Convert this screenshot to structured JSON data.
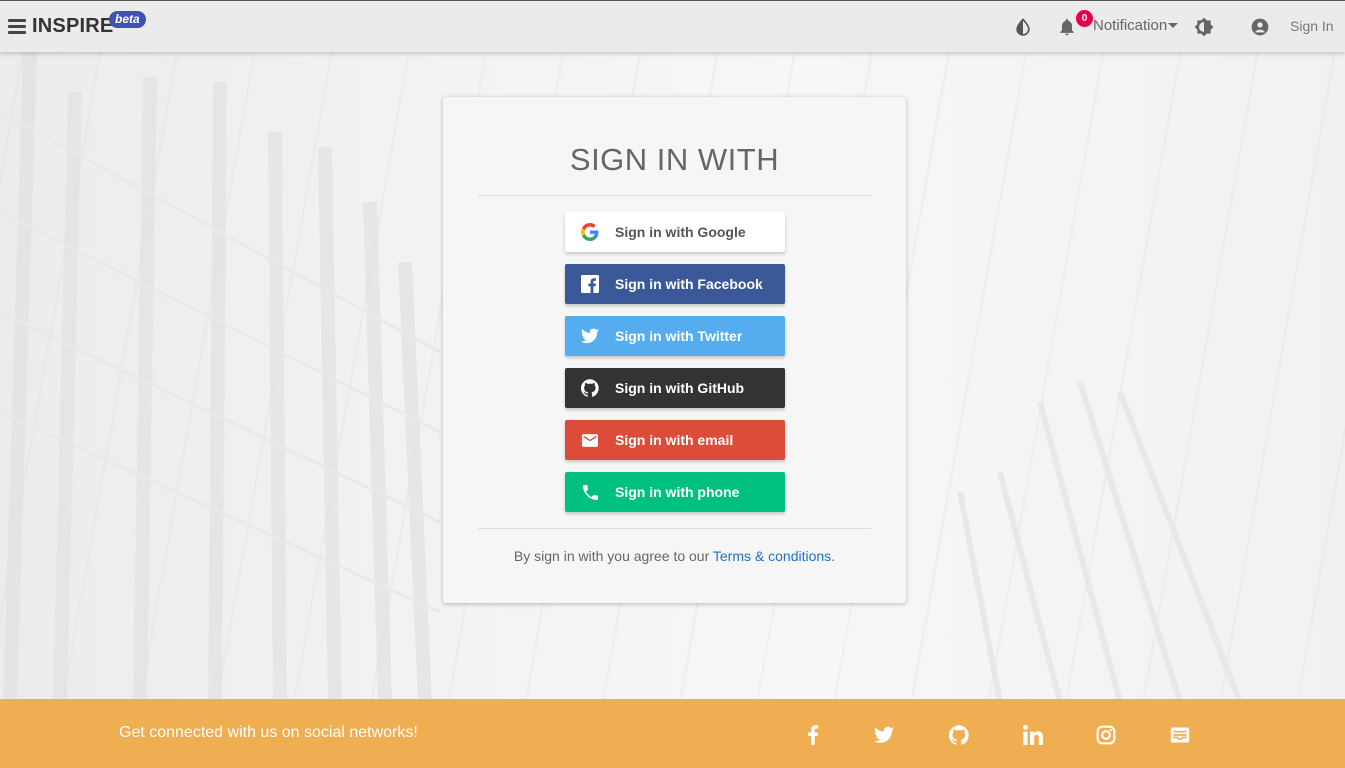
{
  "navbar": {
    "brand": "INSPIRE",
    "badge": "beta",
    "notification_count": "0",
    "notification_label": "Notification",
    "signin_label": "Sign In"
  },
  "card": {
    "title": "SIGN IN WITH",
    "buttons": [
      {
        "label": "Sign in with Google",
        "icon": "google-icon",
        "color": "#ffffff"
      },
      {
        "label": "Sign in with Facebook",
        "icon": "facebook-icon",
        "color": "#3b5998"
      },
      {
        "label": "Sign in with Twitter",
        "icon": "twitter-icon",
        "color": "#55acee"
      },
      {
        "label": "Sign in with GitHub",
        "icon": "github-icon",
        "color": "#333333"
      },
      {
        "label": "Sign in with email",
        "icon": "email-icon",
        "color": "#dd4b39"
      },
      {
        "label": "Sign in with phone",
        "icon": "phone-icon",
        "color": "#00c07f"
      }
    ],
    "terms_prefix": "By sign in with you agree to our ",
    "terms_link": "Terms & conditions",
    "terms_suffix": "."
  },
  "footer": {
    "text": "Get connected with us on social networks!",
    "color": "#f0ae52",
    "icons": [
      "facebook-icon",
      "twitter-icon",
      "github-icon",
      "linkedin-icon",
      "instagram-icon",
      "mailbox-icon"
    ]
  }
}
